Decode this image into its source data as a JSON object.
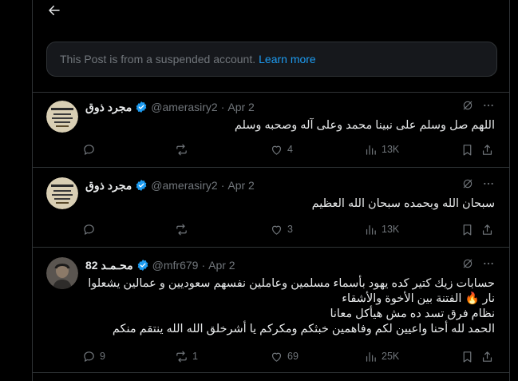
{
  "notice": {
    "text": "This Post is from a suspended account.",
    "link": "Learn more"
  },
  "posts": [
    {
      "name": "مجرد ذوق",
      "handle": "@amerasiry2",
      "date": "Apr 2",
      "verified_color": "#1d9bf0",
      "lines": [
        "اللهم صل وسلم على نبينا محمد وعلى آله وصحبه وسلم"
      ],
      "replies": "",
      "reposts": "",
      "likes": "4",
      "views": "13K"
    },
    {
      "name": "مجرد ذوق",
      "handle": "@amerasiry2",
      "date": "Apr 2",
      "verified_color": "#1d9bf0",
      "lines": [
        "سبحان الله وبحمده سبحان الله العظيم"
      ],
      "replies": "",
      "reposts": "",
      "likes": "3",
      "views": "13K"
    },
    {
      "name": "محـمـد 82",
      "handle": "@mfr679",
      "date": "Apr 2",
      "verified_color": "#1d9bf0",
      "lines": [
        "حسابات زيك كتير كده يهود بأسماء مسلمين وعاملين نفسهم سعوديين و عمالين يشعلوا",
        "نار 🔥 الفتنة بين الأخوة والأشقاء",
        "نظام فرق تسد ده مش هيأكل معانا",
        "الحمد لله أحنا واعيين لكم وفاهمين خبثكم ومكركم يا أشرخلق الله الله ينتقم منكم"
      ],
      "replies": "9",
      "reposts": "1",
      "likes": "69",
      "views": "25K"
    }
  ],
  "icons": [
    "back-arrow-icon",
    "grok-icon",
    "more-icon",
    "reply-icon",
    "repost-icon",
    "like-icon",
    "views-icon",
    "bookmark-icon",
    "share-icon",
    "verified-icon"
  ]
}
